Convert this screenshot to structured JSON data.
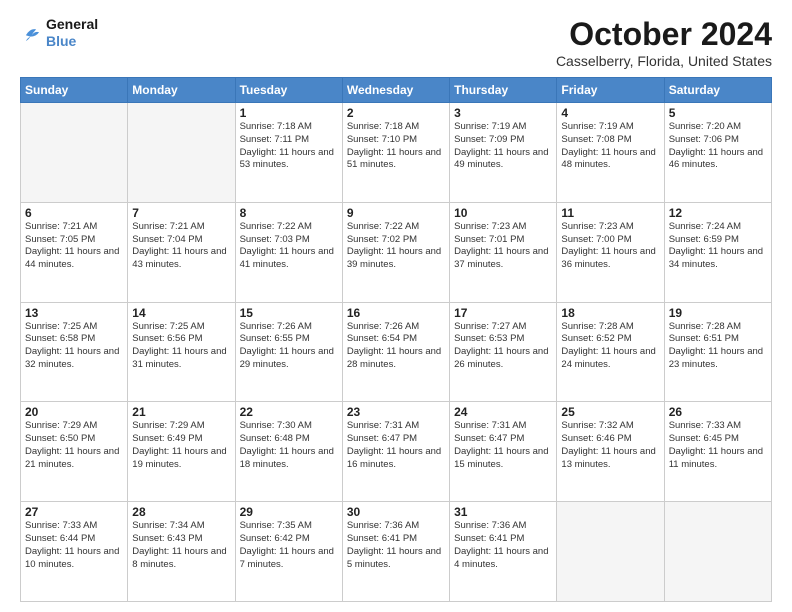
{
  "logo": {
    "line1": "General",
    "line2": "Blue"
  },
  "title": "October 2024",
  "location": "Casselberry, Florida, United States",
  "headers": [
    "Sunday",
    "Monday",
    "Tuesday",
    "Wednesday",
    "Thursday",
    "Friday",
    "Saturday"
  ],
  "weeks": [
    [
      {
        "day": "",
        "info": ""
      },
      {
        "day": "",
        "info": ""
      },
      {
        "day": "1",
        "info": "Sunrise: 7:18 AM\nSunset: 7:11 PM\nDaylight: 11 hours and 53 minutes."
      },
      {
        "day": "2",
        "info": "Sunrise: 7:18 AM\nSunset: 7:10 PM\nDaylight: 11 hours and 51 minutes."
      },
      {
        "day": "3",
        "info": "Sunrise: 7:19 AM\nSunset: 7:09 PM\nDaylight: 11 hours and 49 minutes."
      },
      {
        "day": "4",
        "info": "Sunrise: 7:19 AM\nSunset: 7:08 PM\nDaylight: 11 hours and 48 minutes."
      },
      {
        "day": "5",
        "info": "Sunrise: 7:20 AM\nSunset: 7:06 PM\nDaylight: 11 hours and 46 minutes."
      }
    ],
    [
      {
        "day": "6",
        "info": "Sunrise: 7:21 AM\nSunset: 7:05 PM\nDaylight: 11 hours and 44 minutes."
      },
      {
        "day": "7",
        "info": "Sunrise: 7:21 AM\nSunset: 7:04 PM\nDaylight: 11 hours and 43 minutes."
      },
      {
        "day": "8",
        "info": "Sunrise: 7:22 AM\nSunset: 7:03 PM\nDaylight: 11 hours and 41 minutes."
      },
      {
        "day": "9",
        "info": "Sunrise: 7:22 AM\nSunset: 7:02 PM\nDaylight: 11 hours and 39 minutes."
      },
      {
        "day": "10",
        "info": "Sunrise: 7:23 AM\nSunset: 7:01 PM\nDaylight: 11 hours and 37 minutes."
      },
      {
        "day": "11",
        "info": "Sunrise: 7:23 AM\nSunset: 7:00 PM\nDaylight: 11 hours and 36 minutes."
      },
      {
        "day": "12",
        "info": "Sunrise: 7:24 AM\nSunset: 6:59 PM\nDaylight: 11 hours and 34 minutes."
      }
    ],
    [
      {
        "day": "13",
        "info": "Sunrise: 7:25 AM\nSunset: 6:58 PM\nDaylight: 11 hours and 32 minutes."
      },
      {
        "day": "14",
        "info": "Sunrise: 7:25 AM\nSunset: 6:56 PM\nDaylight: 11 hours and 31 minutes."
      },
      {
        "day": "15",
        "info": "Sunrise: 7:26 AM\nSunset: 6:55 PM\nDaylight: 11 hours and 29 minutes."
      },
      {
        "day": "16",
        "info": "Sunrise: 7:26 AM\nSunset: 6:54 PM\nDaylight: 11 hours and 28 minutes."
      },
      {
        "day": "17",
        "info": "Sunrise: 7:27 AM\nSunset: 6:53 PM\nDaylight: 11 hours and 26 minutes."
      },
      {
        "day": "18",
        "info": "Sunrise: 7:28 AM\nSunset: 6:52 PM\nDaylight: 11 hours and 24 minutes."
      },
      {
        "day": "19",
        "info": "Sunrise: 7:28 AM\nSunset: 6:51 PM\nDaylight: 11 hours and 23 minutes."
      }
    ],
    [
      {
        "day": "20",
        "info": "Sunrise: 7:29 AM\nSunset: 6:50 PM\nDaylight: 11 hours and 21 minutes."
      },
      {
        "day": "21",
        "info": "Sunrise: 7:29 AM\nSunset: 6:49 PM\nDaylight: 11 hours and 19 minutes."
      },
      {
        "day": "22",
        "info": "Sunrise: 7:30 AM\nSunset: 6:48 PM\nDaylight: 11 hours and 18 minutes."
      },
      {
        "day": "23",
        "info": "Sunrise: 7:31 AM\nSunset: 6:47 PM\nDaylight: 11 hours and 16 minutes."
      },
      {
        "day": "24",
        "info": "Sunrise: 7:31 AM\nSunset: 6:47 PM\nDaylight: 11 hours and 15 minutes."
      },
      {
        "day": "25",
        "info": "Sunrise: 7:32 AM\nSunset: 6:46 PM\nDaylight: 11 hours and 13 minutes."
      },
      {
        "day": "26",
        "info": "Sunrise: 7:33 AM\nSunset: 6:45 PM\nDaylight: 11 hours and 11 minutes."
      }
    ],
    [
      {
        "day": "27",
        "info": "Sunrise: 7:33 AM\nSunset: 6:44 PM\nDaylight: 11 hours and 10 minutes."
      },
      {
        "day": "28",
        "info": "Sunrise: 7:34 AM\nSunset: 6:43 PM\nDaylight: 11 hours and 8 minutes."
      },
      {
        "day": "29",
        "info": "Sunrise: 7:35 AM\nSunset: 6:42 PM\nDaylight: 11 hours and 7 minutes."
      },
      {
        "day": "30",
        "info": "Sunrise: 7:36 AM\nSunset: 6:41 PM\nDaylight: 11 hours and 5 minutes."
      },
      {
        "day": "31",
        "info": "Sunrise: 7:36 AM\nSunset: 6:41 PM\nDaylight: 11 hours and 4 minutes."
      },
      {
        "day": "",
        "info": ""
      },
      {
        "day": "",
        "info": ""
      }
    ]
  ]
}
